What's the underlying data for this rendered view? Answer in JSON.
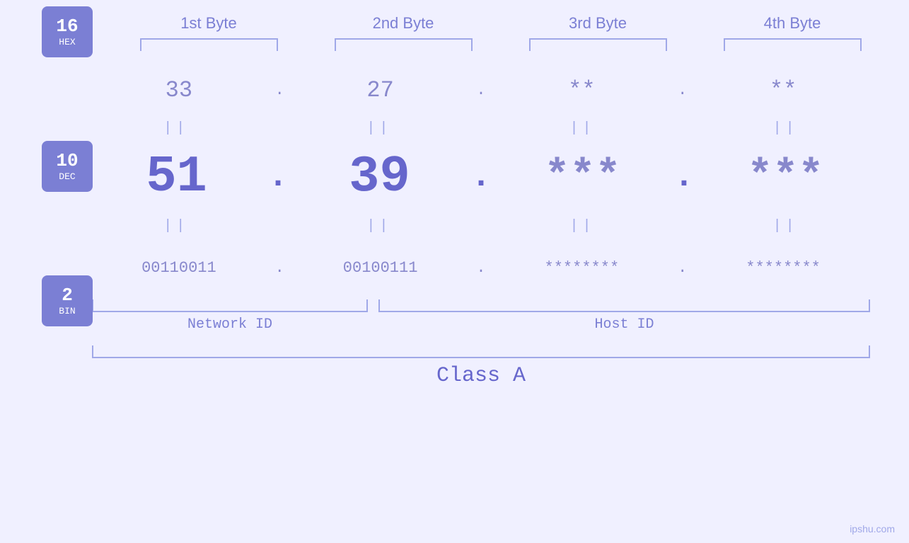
{
  "headers": {
    "byte1": "1st Byte",
    "byte2": "2nd Byte",
    "byte3": "3rd Byte",
    "byte4": "4th Byte"
  },
  "bases": [
    {
      "number": "16",
      "name": "HEX"
    },
    {
      "number": "10",
      "name": "DEC"
    },
    {
      "number": "2",
      "name": "BIN"
    }
  ],
  "hex_row": {
    "b1": "33",
    "b2": "27",
    "b3": "**",
    "b4": "**",
    "sep": "."
  },
  "dec_row": {
    "b1": "51",
    "b2": "39",
    "b3": "***",
    "b4": "***",
    "sep": "."
  },
  "bin_row": {
    "b1": "00110011",
    "b2": "00100111",
    "b3": "********",
    "b4": "********",
    "sep": "."
  },
  "labels": {
    "network_id": "Network ID",
    "host_id": "Host ID",
    "class": "Class A"
  },
  "watermark": "ipshu.com"
}
